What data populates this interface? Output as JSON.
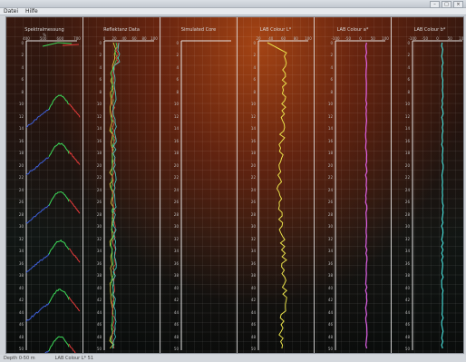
{
  "window": {
    "controls": [
      "–",
      "□",
      "×"
    ]
  },
  "menu": [
    "Datei",
    "Hilfe"
  ],
  "colors": {
    "green": "#3ddc5a",
    "red": "#e43a3a",
    "blue": "#3e5fd8",
    "yellow": "#e8e04a",
    "magenta": "#e060e8",
    "cyan": "#46d6d2",
    "axis": "#e6e6e6"
  },
  "panels": [
    {
      "title": "Spektralmessung",
      "ticks": [
        "400",
        "500",
        "600",
        "700"
      ],
      "tick_unit": "%"
    },
    {
      "title": "Reflektanz Data",
      "ticks": [
        "0",
        "20",
        "40",
        "60",
        "80",
        "100"
      ]
    },
    {
      "title": "Simulated Core",
      "ticks": []
    },
    {
      "title": "LAB Colour L*",
      "ticks": [
        "20",
        "40",
        "60",
        "80",
        "100"
      ]
    },
    {
      "title": "LAB Colour a*",
      "ticks": [
        "-100",
        "-50",
        "0",
        "50",
        "100"
      ]
    },
    {
      "title": "LAB Colour b*",
      "ticks": [
        "-100",
        "-50",
        "0",
        "50",
        "100"
      ]
    }
  ],
  "depths": [
    "0",
    "2",
    "4",
    "6",
    "8",
    "10",
    "12",
    "14",
    "16",
    "18",
    "20",
    "22",
    "24",
    "26",
    "28",
    "30",
    "32",
    "34",
    "36",
    "38",
    "40",
    "42",
    "44",
    "46",
    "48",
    "50"
  ],
  "status": {
    "left": "Depth 0-50 m",
    "right": "LAB Colour L*  51"
  }
}
